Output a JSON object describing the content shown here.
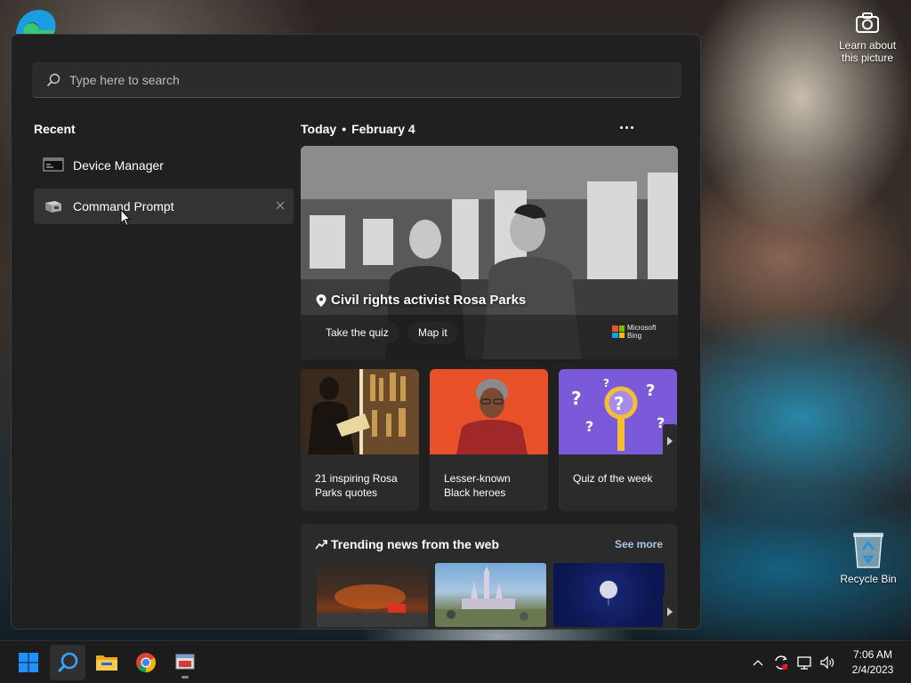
{
  "desktop": {
    "camera_label": "Learn about this picture",
    "recycle_bin_label": "Recycle Bin"
  },
  "search": {
    "placeholder": "Type here to search"
  },
  "recent": {
    "title": "Recent",
    "items": [
      {
        "label": "Device Manager",
        "icon": "device-manager-icon"
      },
      {
        "label": "Command Prompt",
        "icon": "command-prompt-icon"
      }
    ]
  },
  "today": {
    "label": "Today",
    "date": "February 4"
  },
  "hero": {
    "title": "Civil rights activist Rosa Parks",
    "quiz_button": "Take the quiz",
    "map_button": "Map it",
    "badge_line1": "Microsoft",
    "badge_line2": "Bing"
  },
  "cards": [
    {
      "caption": "21 inspiring Rosa Parks quotes"
    },
    {
      "caption": "Lesser-known Black heroes"
    },
    {
      "caption": "Quiz of the week"
    }
  ],
  "trending": {
    "title": "Trending news from the web",
    "see_more": "See more"
  },
  "taskbar": {
    "time": "7:06 AM",
    "date": "2/4/2023"
  },
  "colors": {
    "flyout_bg": "#202020",
    "card_bg": "#2b2b2b",
    "taskbar_bg": "#1c1c1c",
    "accent_link": "#a9c7e8",
    "windows_blue": "#1e90ff"
  }
}
